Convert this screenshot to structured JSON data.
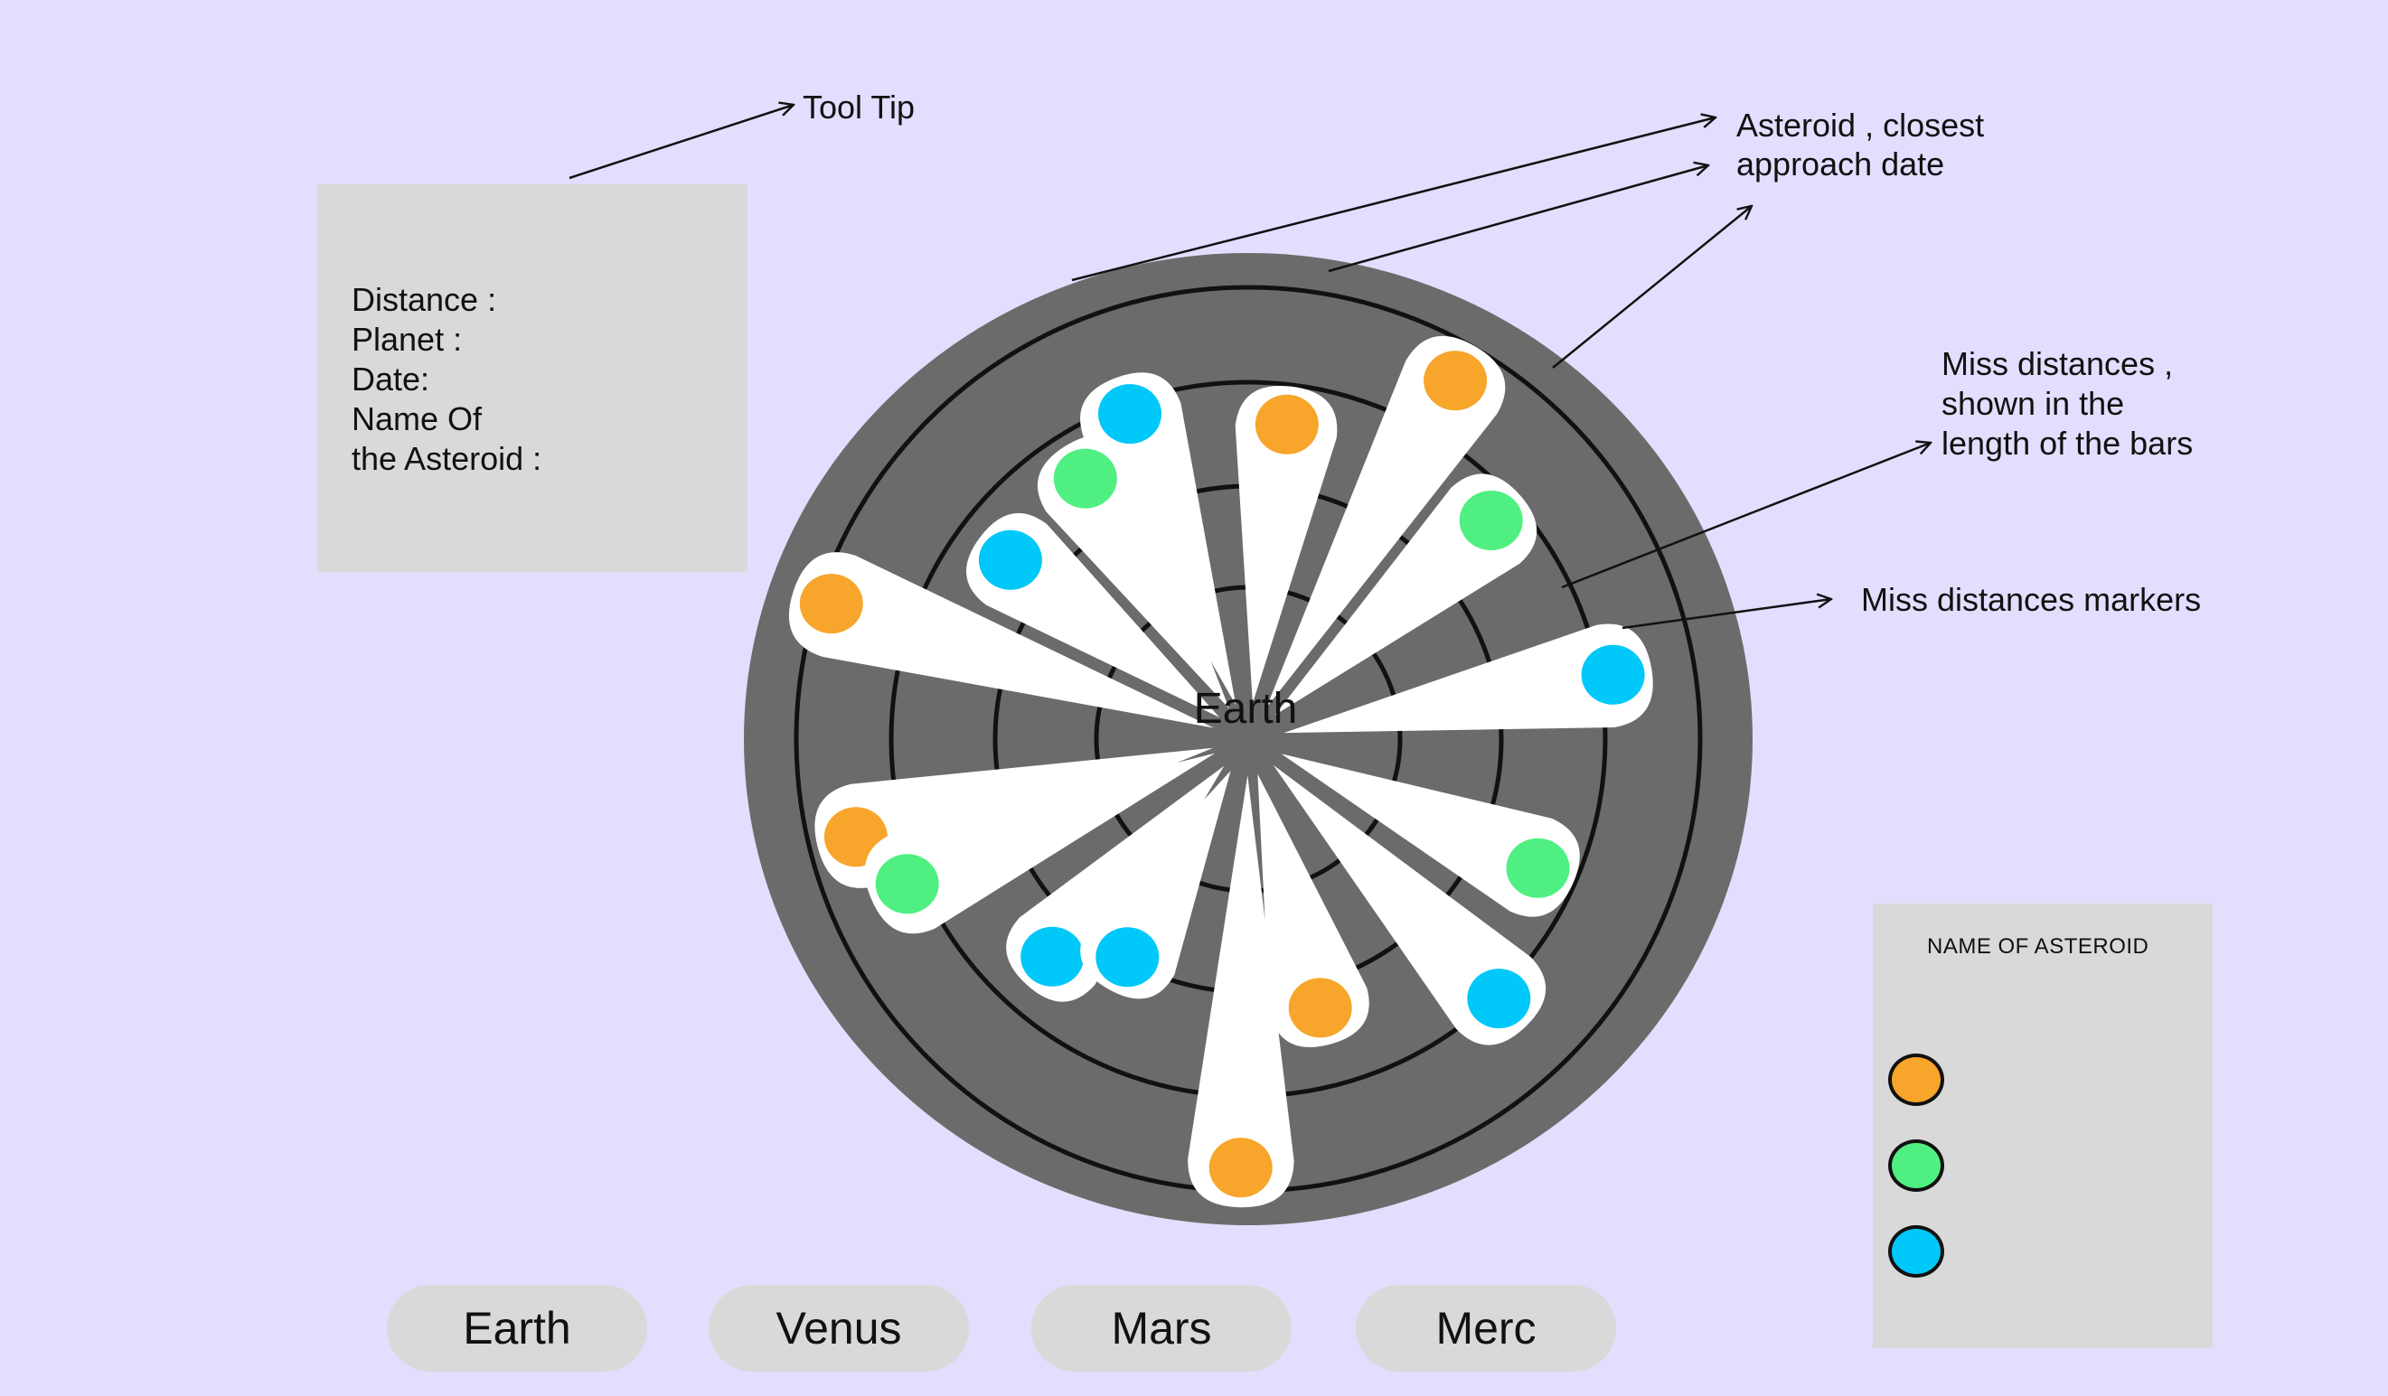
{
  "tooltip": {
    "heading": "Tool Tip",
    "lines": [
      "Distance :",
      "Planet :",
      "Date:",
      "Name Of",
      "the Asteroid :"
    ]
  },
  "diagram": {
    "center_label": "Earth",
    "ring_count": 4,
    "colors": {
      "background": "#e3defe",
      "disc": "#6b6b6b",
      "bar": "#ffffff",
      "ring_stroke": "#111111",
      "orange": "#f7a52b",
      "green": "#4ff081",
      "cyan": "#00c8f8"
    },
    "bars": [
      {
        "angle_deg": 250,
        "length": 0.7,
        "color": "cyan"
      },
      {
        "angle_deg": 238,
        "length": 0.62,
        "color": "green"
      },
      {
        "angle_deg": 217,
        "length": 0.6,
        "color": "cyan"
      },
      {
        "angle_deg": 198,
        "length": 0.89,
        "color": "orange"
      },
      {
        "angle_deg": 166,
        "length": 0.82,
        "color": "orange"
      },
      {
        "angle_deg": 157,
        "length": 0.75,
        "color": "green"
      },
      {
        "angle_deg": 132,
        "length": 0.59,
        "color": "cyan"
      },
      {
        "angle_deg": 119,
        "length": 0.5,
        "color": "cyan"
      },
      {
        "angle_deg": 91,
        "length": 0.87,
        "color": "orange"
      },
      {
        "angle_deg": 75,
        "length": 0.56,
        "color": "orange"
      },
      {
        "angle_deg": 46,
        "length": 0.73,
        "color": "cyan"
      },
      {
        "angle_deg": 24,
        "length": 0.64,
        "color": "green"
      },
      {
        "angle_deg": 350,
        "length": 0.75,
        "color": "cyan"
      },
      {
        "angle_deg": 318,
        "length": 0.66,
        "color": "green"
      },
      {
        "angle_deg": 300,
        "length": 0.84,
        "color": "orange"
      },
      {
        "angle_deg": 277,
        "length": 0.64,
        "color": "orange"
      }
    ]
  },
  "annotations": {
    "asteroid_date": [
      "Asteroid , closest",
      "approach date"
    ],
    "miss_distances": [
      "Miss distances ,",
      "shown in the",
      "length of the bars"
    ],
    "markers": "Miss distances markers"
  },
  "legend": {
    "title": "NAME OF ASTEROID",
    "items": [
      {
        "color": "#f7a52b"
      },
      {
        "color": "#4ff081"
      },
      {
        "color": "#00c8f8"
      }
    ]
  },
  "planets": {
    "buttons": [
      "Earth",
      "Venus",
      "Mars",
      "Merc"
    ]
  }
}
